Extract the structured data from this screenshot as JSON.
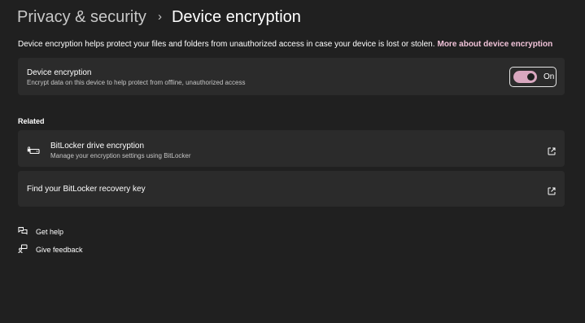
{
  "breadcrumb": {
    "parent": "Privacy & security",
    "separator": "›",
    "current": "Device encryption"
  },
  "description": {
    "text": "Device encryption helps protect your files and folders from unauthorized access in case your device is lost or stolen.",
    "link": "More about device encryption"
  },
  "encryption_card": {
    "title": "Device encryption",
    "subtitle": "Encrypt data on this device to help protect from offline, unauthorized access",
    "toggle_state": "On",
    "toggle_on": true
  },
  "related": {
    "heading": "Related",
    "items": [
      {
        "title": "BitLocker drive encryption",
        "subtitle": "Manage your encryption settings using BitLocker",
        "icon": "drive-lock-icon",
        "action_icon": "open-external-icon"
      },
      {
        "title": "Find your BitLocker recovery key",
        "action_icon": "open-external-icon"
      }
    ]
  },
  "help": {
    "get_help": "Get help",
    "give_feedback": "Give feedback"
  },
  "colors": {
    "background": "#202020",
    "card": "#2b2b2b",
    "accent": "#d9a7bf",
    "link": "#f0c2d8"
  }
}
